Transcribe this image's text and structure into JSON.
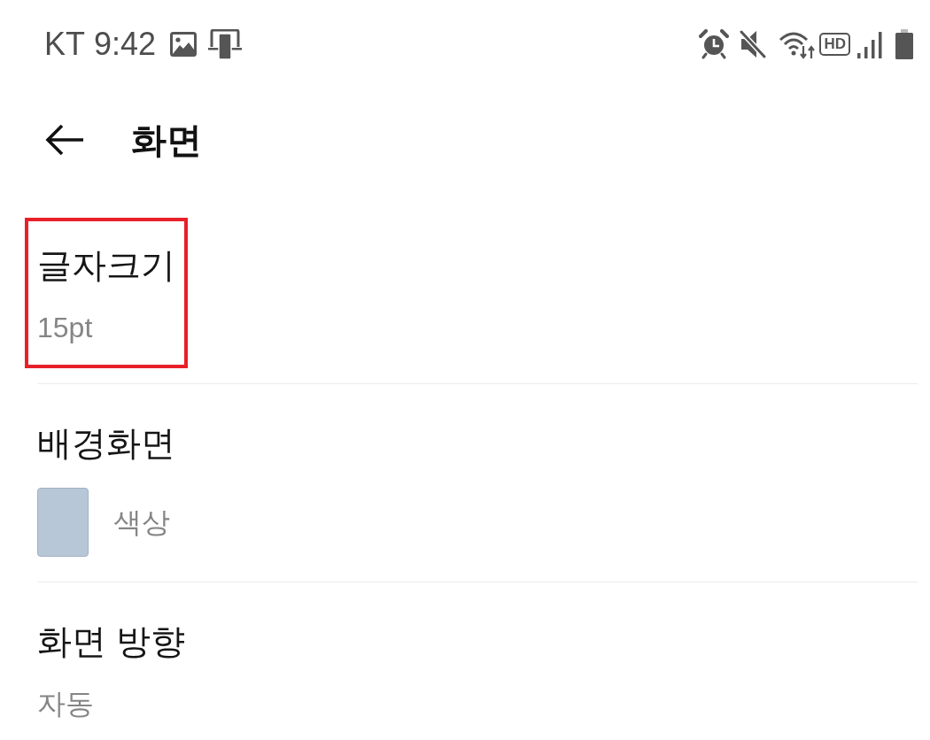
{
  "status_bar": {
    "carrier": "KT",
    "time": "9:42",
    "hd_label": "HD"
  },
  "header": {
    "title": "화면"
  },
  "settings": [
    {
      "kind": "text",
      "title": "글자크기",
      "value": "15pt",
      "highlighted": true
    },
    {
      "kind": "swatch",
      "title": "배경화면",
      "value": "색상",
      "color": "#b7c7d7",
      "highlighted": false
    },
    {
      "kind": "text",
      "title": "화면 방향",
      "value": "자동",
      "highlighted": false
    }
  ]
}
